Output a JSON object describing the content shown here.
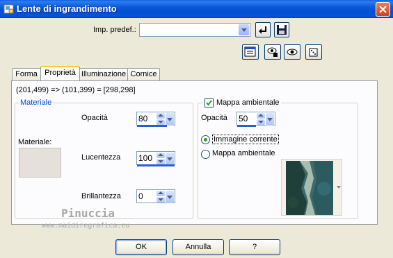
{
  "window": {
    "title": "Lente di ingrandimento"
  },
  "preset": {
    "label": "Imp. predef.:",
    "value": ""
  },
  "tabs": [
    {
      "label": "Forma",
      "active": false
    },
    {
      "label": "Proprietà",
      "active": true
    },
    {
      "label": "Illuminazione",
      "active": false
    },
    {
      "label": "Cornice",
      "active": false
    }
  ],
  "coords": "(201,499) => (101,399) = [298,298]",
  "materiale": {
    "group_label": "Materiale",
    "opacita_label": "Opacità",
    "opacita_value": "80",
    "opacita_level": 0.8,
    "materiale_label": "Materiale:",
    "swatch_color": "#e6e0da",
    "lucentezza_label": "Lucentezza",
    "lucentezza_value": "100",
    "lucentezza_level": 1.0,
    "brillantezza_label": "Brillantezza",
    "brillantezza_value": "0",
    "brillantezza_level": 0.0
  },
  "ambientale": {
    "checkbox_label": "Mappa ambientale",
    "checked": true,
    "opacita_label": "Opacità",
    "opacita_value": "50",
    "opacita_level": 0.5,
    "radio_current": "Immagine corrente",
    "radio_map": "Mappa ambientale",
    "selected": "Immagine corrente"
  },
  "watermark": {
    "name": "Pinuccia",
    "site": "www.maidiregrafica.eu"
  },
  "buttons": {
    "ok": "OK",
    "cancel": "Annulla",
    "help": "?"
  },
  "colors": {
    "accent": "#0046d5",
    "title_bar": "#0554d8"
  }
}
